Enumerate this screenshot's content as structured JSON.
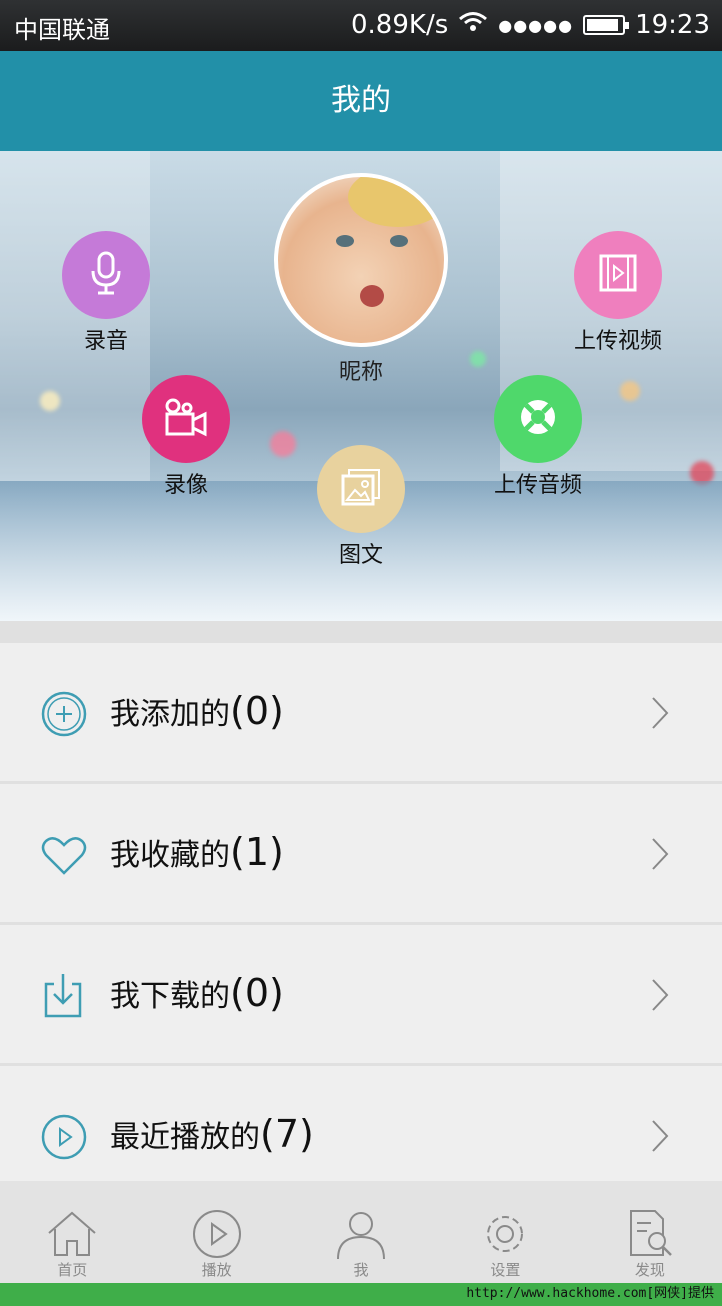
{
  "status_bar": {
    "carrier": "中国联通",
    "speed": "0.89K/s",
    "signal_dots": "●●●●●",
    "battery_level": 0.9,
    "time": "19:23"
  },
  "title": "我的",
  "profile": {
    "nickname": "昵称"
  },
  "actions": [
    {
      "label": "录音",
      "color": "#c57ad8",
      "icon": "microphone-icon"
    },
    {
      "label": "上传视频",
      "color": "#ef7fbe",
      "icon": "film-icon"
    },
    {
      "label": "录像",
      "color": "#e0317e",
      "icon": "video-camera-icon"
    },
    {
      "label": "上传音频",
      "color": "#4fd86b",
      "icon": "lifebuoy-icon"
    },
    {
      "label": "图文",
      "color": "#e8d29e",
      "icon": "picture-icon"
    }
  ],
  "list": [
    {
      "label": "我添加的",
      "count": "(0)",
      "icon": "plus-circle-icon"
    },
    {
      "label": "我收藏的",
      "count": "(1)",
      "icon": "heart-icon"
    },
    {
      "label": "我下载的",
      "count": "(0)",
      "icon": "download-icon"
    },
    {
      "label": "最近播放的",
      "count": "(7)",
      "icon": "play-circle-icon"
    }
  ],
  "tabs": [
    {
      "label": "首页",
      "icon": "home-icon"
    },
    {
      "label": "播放",
      "icon": "play-icon"
    },
    {
      "label": "我",
      "icon": "user-icon"
    },
    {
      "label": "设置",
      "icon": "gear-icon"
    },
    {
      "label": "发现",
      "icon": "discover-search-icon"
    }
  ],
  "footer": "http://www.hackhome.com[网侠]提供",
  "colors": {
    "accent": "#2290a8",
    "icon_teal": "#3e9db3"
  }
}
